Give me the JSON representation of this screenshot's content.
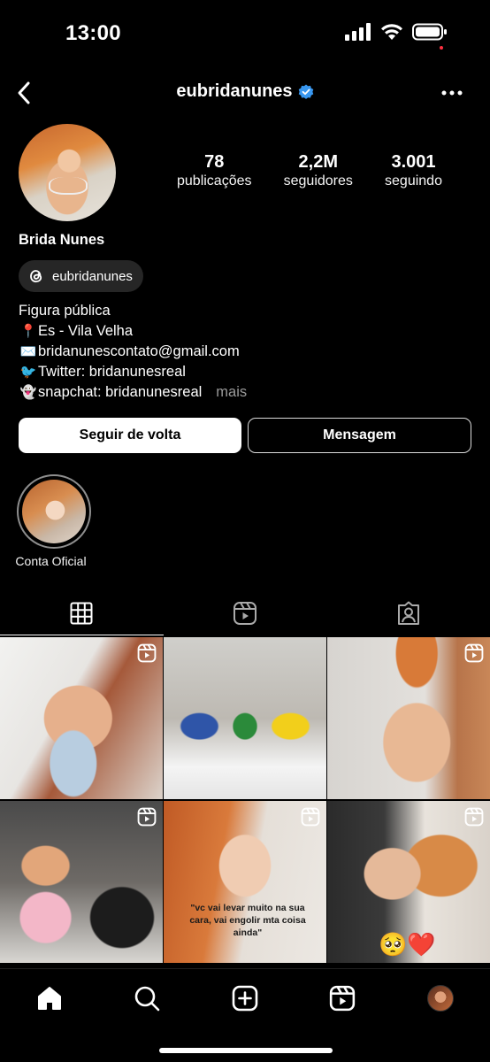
{
  "status_bar": {
    "time": "13:00",
    "icons": [
      "signal-icon",
      "wifi-icon",
      "battery-icon"
    ]
  },
  "header": {
    "username": "eubridanunes",
    "verified": true,
    "icons": [
      "back-icon",
      "verified-badge-icon",
      "more-icon"
    ]
  },
  "profile": {
    "display_name": "Brida Nunes",
    "threads_handle": "eubridanunes",
    "stats": [
      {
        "value": "78",
        "label": "publicações"
      },
      {
        "value": "2,2M",
        "label": "seguidores"
      },
      {
        "value": "3.001",
        "label": "seguindo"
      }
    ],
    "bio": {
      "category": "Figura pública",
      "lines": [
        {
          "emoji": "📍",
          "text": "Es - Vila Velha"
        },
        {
          "emoji": "✉️",
          "text": "bridanunescontato@gmail.com"
        },
        {
          "emoji": "🐦",
          "text": "Twitter: bridanunesreal"
        },
        {
          "emoji": "👻",
          "text": "snapchat: bridanunesreal"
        }
      ],
      "more": "mais"
    }
  },
  "actions": {
    "follow_back": "Seguir de volta",
    "message": "Mensagem"
  },
  "highlights": [
    {
      "label": "Conta Oficial"
    }
  ],
  "tabs": [
    "grid-icon",
    "reels-icon",
    "tagged-icon"
  ],
  "posts": [
    {
      "type": "reel"
    },
    {
      "type": "photo"
    },
    {
      "type": "reel"
    },
    {
      "type": "reel"
    },
    {
      "type": "reel",
      "caption": "\"vc vai levar muito na sua cara, vai engolir mta coisa ainda\""
    },
    {
      "type": "reel",
      "emojis": "🥺❤️"
    }
  ],
  "bottom_nav": [
    "home-icon",
    "search-icon",
    "create-icon",
    "reels-icon",
    "profile-avatar"
  ],
  "colors": {
    "background": "#000000",
    "verified": "#3897f0",
    "chip": "#262626",
    "muted": "#9a9a9a",
    "notification": "#ff3040"
  }
}
